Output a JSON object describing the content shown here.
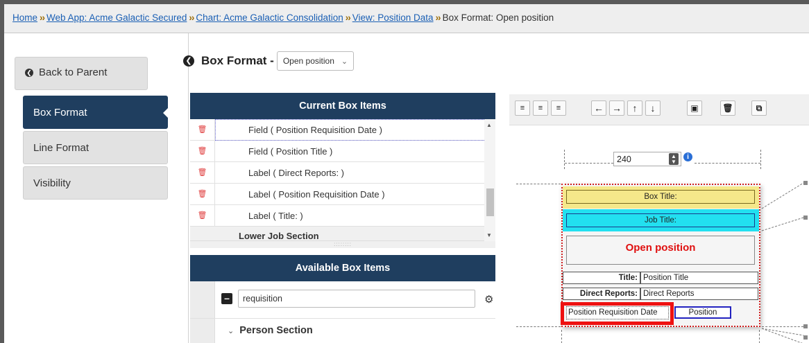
{
  "breadcrumb": {
    "home": "Home",
    "web_app": "Web App: Acme Galactic Secured",
    "chart": "Chart: Acme Galactic Consolidation",
    "view": "View: Position Data",
    "current_prefix": "Box Format:",
    "current_value": "Open position",
    "separator": "››"
  },
  "leftnav": {
    "back_label": "Back to Parent",
    "items": [
      {
        "label": "Box Format",
        "active": true
      },
      {
        "label": "Line Format",
        "active": false
      },
      {
        "label": "Visibility",
        "active": false
      }
    ]
  },
  "header": {
    "title": "Box Format -",
    "select_value": "Open position"
  },
  "current_items": {
    "title": "Current Box Items",
    "rows": [
      "Field  ( Position Requisition Date )",
      "Field  ( Position Title )",
      "Label  ( Direct Reports: )",
      "Label  ( Position Requisition Date )",
      "Label  ( Title: )"
    ],
    "section": "Lower Job Section"
  },
  "available_items": {
    "title": "Available Box Items",
    "search_value": "requisition",
    "section": "Person Section"
  },
  "canvas": {
    "width_value": "240",
    "box_title": "Box Title:",
    "job_title": "Job Title:",
    "open_position": "Open position",
    "title_label": "Title:",
    "title_value": "Position Title",
    "direct_reports_label": "Direct Reports:",
    "direct_reports_value": "Direct Reports",
    "req_date_label": "Position Requisition Date",
    "position_box": "Position"
  },
  "colors": {
    "nav_active": "#1f3e5f",
    "highlight": "#ee1111",
    "title_bar": "#f5e88a",
    "job_bar": "#22e0f0",
    "open_text": "#e01010"
  }
}
